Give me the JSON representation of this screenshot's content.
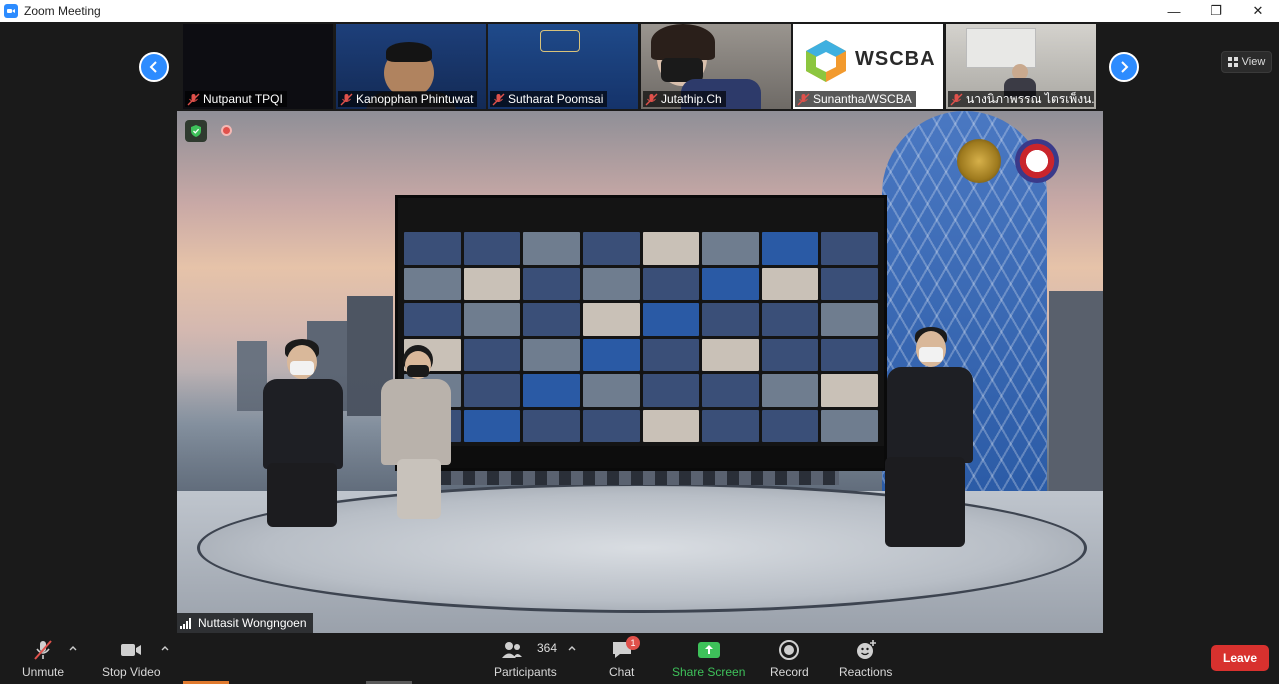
{
  "window": {
    "title": "Zoom Meeting",
    "controls": {
      "minimize": "—",
      "restore": "❐",
      "close": "✕"
    }
  },
  "gallery": {
    "view_label": "View",
    "participants": [
      {
        "name": "Nutpanut TPQI",
        "muted": true,
        "bg": "#0d0d12"
      },
      {
        "name": "Kanopphan Phintuwat",
        "muted": true,
        "bg": "#1d3f7a"
      },
      {
        "name": "Sutharat Poomsai",
        "muted": true,
        "bg": "#1f4a8a"
      },
      {
        "name": "Jutathip.Ch",
        "muted": true,
        "bg": "#8d8a86"
      },
      {
        "name": "Sunantha/WSCBA",
        "muted": true,
        "bg": "#ffffff"
      },
      {
        "name": "นางนิภาพรรณ ไตรเพ็งน...",
        "muted": true,
        "bg": "#c9c7c2"
      }
    ],
    "wscba_text": "WSCBA"
  },
  "main_video": {
    "speaker_name": "Nuttasit Wongngoen"
  },
  "toolbar": {
    "unmute": "Unmute",
    "stop_video": "Stop Video",
    "participants": "Participants",
    "participants_count": "364",
    "chat": "Chat",
    "chat_badge": "1",
    "share_screen": "Share Screen",
    "record": "Record",
    "reactions": "Reactions",
    "leave": "Leave"
  },
  "colors": {
    "accent": "#2d8cff",
    "share_green": "#3ec15a",
    "leave_red": "#d8312e",
    "toolbar_bg": "#1a1a1a"
  }
}
